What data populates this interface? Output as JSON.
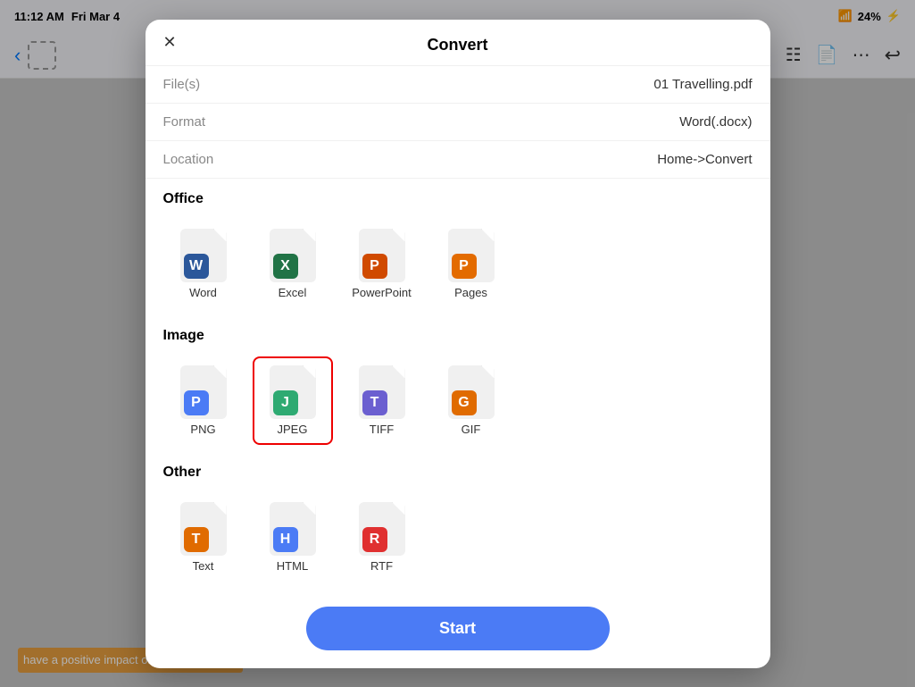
{
  "statusBar": {
    "time": "11:12 AM",
    "date": "Fri Mar 4",
    "battery": "24%",
    "wifiIcon": "wifi"
  },
  "toolbar": {
    "backLabel": "‹",
    "icons": [
      "search",
      "grid",
      "document",
      "more"
    ],
    "undoLabel": "↩"
  },
  "modal": {
    "title": "Convert",
    "closeLabel": "✕",
    "fields": {
      "filesLabel": "File(s)",
      "filesValue": "01 Travelling.pdf",
      "formatLabel": "Format",
      "formatValue": "Word(.docx)",
      "locationLabel": "Location",
      "locationValue": "Home->Convert"
    },
    "sections": {
      "office": {
        "label": "Office",
        "items": [
          {
            "id": "word",
            "name": "Word",
            "badge": "W",
            "badgeColor": "#2B579A",
            "bgColor": "#e8f0fb"
          },
          {
            "id": "excel",
            "name": "Excel",
            "badge": "X",
            "badgeColor": "#217346",
            "bgColor": "#e2f4ea"
          },
          {
            "id": "powerpoint",
            "name": "PowerPoint",
            "badge": "P",
            "badgeColor": "#D04A00",
            "bgColor": "#fde8dc"
          },
          {
            "id": "pages",
            "name": "Pages",
            "badge": "P",
            "badgeColor": "#E36B00",
            "bgColor": "#fef0dd"
          }
        ]
      },
      "image": {
        "label": "Image",
        "items": [
          {
            "id": "png",
            "name": "PNG",
            "badge": "P",
            "badgeColor": "#4B7BF5",
            "bgColor": "#dfe8fd"
          },
          {
            "id": "jpeg",
            "name": "JPEG",
            "badge": "J",
            "badgeColor": "#2EAA72",
            "bgColor": "#dcf5ea",
            "selected": true
          },
          {
            "id": "tiff",
            "name": "TIFF",
            "badge": "T",
            "badgeColor": "#6B5FD0",
            "bgColor": "#eae8fc"
          },
          {
            "id": "gif",
            "name": "GIF",
            "badge": "G",
            "badgeColor": "#E06B00",
            "bgColor": "#fef0dd"
          }
        ]
      },
      "other": {
        "label": "Other",
        "items": [
          {
            "id": "text",
            "name": "Text",
            "badge": "T",
            "badgeColor": "#E06B00",
            "bgColor": "#fef0dd"
          },
          {
            "id": "html",
            "name": "HTML",
            "badge": "H",
            "badgeColor": "#4B7BF5",
            "bgColor": "#dfe8fd"
          },
          {
            "id": "rtf",
            "name": "RTF",
            "badge": "R",
            "badgeColor": "#E03030",
            "bgColor": "#fde0de"
          }
        ]
      }
    },
    "startButton": "Start"
  },
  "bottomText": "have a positive impact on your health and"
}
